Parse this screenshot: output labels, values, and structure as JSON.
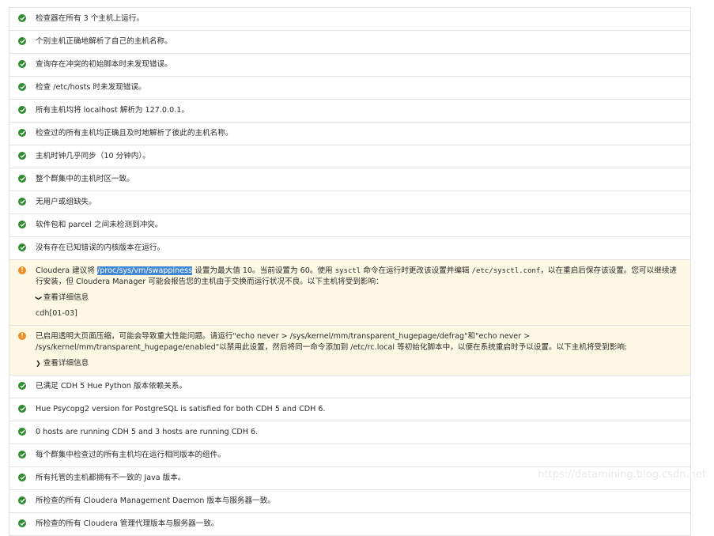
{
  "checks": [
    {
      "status": "ok",
      "text": "检查器在所有 3 个主机上运行。"
    },
    {
      "status": "ok",
      "text": "个别主机正确地解析了自己的主机名称。"
    },
    {
      "status": "ok",
      "text": "查询存在冲突的初始脚本时未发现错误。"
    },
    {
      "status": "ok",
      "text": "检查 /etc/hosts 时未发现错误。"
    },
    {
      "status": "ok",
      "text": "所有主机均将 localhost 解析为 127.0.0.1。"
    },
    {
      "status": "ok",
      "text": "检查过的所有主机均正确且及时地解析了彼此的主机名称。"
    },
    {
      "status": "ok",
      "text": "主机时钟几乎同步（10 分钟内）。"
    },
    {
      "status": "ok",
      "text": "整个群集中的主机时区一致。"
    },
    {
      "status": "ok",
      "text": "无用户或组缺失。"
    },
    {
      "status": "ok",
      "text": "软件包和 parcel 之间未检测到冲突。"
    },
    {
      "status": "ok",
      "text": "没有存在已知错误的内核版本在运行。"
    }
  ],
  "warning1": {
    "prefix": "Cloudera 建议将 ",
    "path": "/proc/sys/vm/swappiness",
    "mid1": " 设置为最大值 10。当前设置为 60。使用 ",
    "cmd1": "sysctl",
    "mid2": " 命令在运行时更改该设置并编辑 ",
    "cmd2": "/etc/sysctl.conf",
    "suffix": "，以在重启后保存该设置。您可以继续进行安装，但 Cloudera Manager 可能会报告您的主机由于交换而运行状况不良。以下主机将受到影响：",
    "details_label": "查看详细信息",
    "hosts": "cdh[01-03]"
  },
  "warning2": {
    "text": "已启用透明大页面压缩，可能会导致重大性能问题。请运行\"echo never > /sys/kernel/mm/transparent_hugepage/defrag\"和\"echo never > /sys/kernel/mm/transparent_hugepage/enabled\"以禁用此设置，然后将同一命令添加到 /etc/rc.local 等初始化脚本中，以便在系统重启时予以设置。以下主机将受到影响:",
    "details_label": "查看详细信息"
  },
  "checks2": [
    {
      "status": "ok",
      "text": "已满足 CDH 5 Hue Python 版本依赖关系。"
    },
    {
      "status": "ok",
      "text": "Hue Psycopg2 version for PostgreSQL is satisfied for both CDH 5 and CDH 6."
    },
    {
      "status": "ok",
      "text": "0 hosts are running CDH 5 and 3 hosts are running CDH 6."
    },
    {
      "status": "ok",
      "text": "每个群集中检查过的所有主机均在运行相同版本的组件。"
    },
    {
      "status": "ok",
      "text": "所有托管的主机都拥有不一致的 Java 版本。"
    },
    {
      "status": "ok",
      "text": "所检查的所有 Cloudera Management Daemon 版本与服务器一致。"
    },
    {
      "status": "ok",
      "text": "所检查的所有 Cloudera 管理代理版本与服务器一致。"
    }
  ],
  "watermark": "https://datamining.blog.csdn.net",
  "colors": {
    "ok": "#2e8c2e",
    "warn": "#f08c1f",
    "warn_bg": "#fcf8e3",
    "highlight": "#3f86d6"
  }
}
